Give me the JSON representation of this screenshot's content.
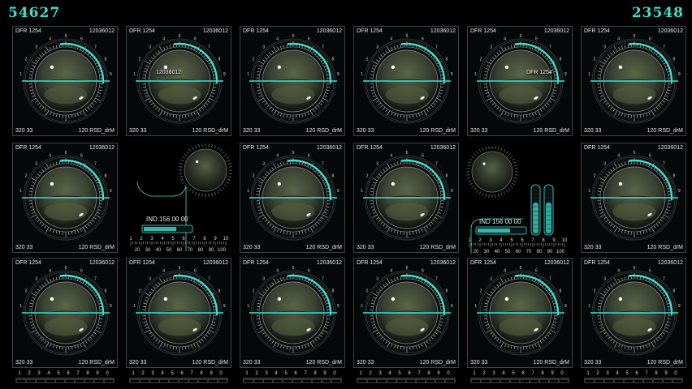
{
  "counters": {
    "left": "54627",
    "right": "23548"
  },
  "panel_labels": {
    "top_left": "DFR 1254",
    "top_right": "12036012",
    "bottom_left": "320 33",
    "bottom_right": "120 RSD_drM"
  },
  "overlays": {
    "cell_0_1": "12036012",
    "cell_0_4": "DFR 1254"
  },
  "dial_scale": [
    "1",
    "2",
    "3",
    "4",
    "5",
    "6",
    "7",
    "8",
    "9"
  ],
  "aux_a": {
    "ind_label": "IND 156 00 00",
    "scale": [
      "1",
      "2",
      "3",
      "4",
      "5",
      "6",
      "7",
      "8",
      "9",
      "10"
    ],
    "scale_bottom": [
      "20",
      "30",
      "40",
      "50",
      "60",
      "70",
      "80",
      "90",
      "100"
    ]
  },
  "aux_b": {
    "ind_label": "IND 156 00 00",
    "scale": [
      "1",
      "2",
      "3",
      "4",
      "5",
      "6",
      "7",
      "8",
      "9",
      "10"
    ],
    "scale_bottom": [
      "20",
      "30",
      "40",
      "50",
      "60",
      "70",
      "80",
      "90",
      "100"
    ]
  },
  "ruler_labels": [
    "1",
    "2",
    "3",
    "4",
    "5",
    "6",
    "7",
    "8",
    "9",
    "0"
  ],
  "colors": {
    "accent": "#3fe0d0",
    "frame": "#3a4444",
    "lens": "#4a5540"
  }
}
